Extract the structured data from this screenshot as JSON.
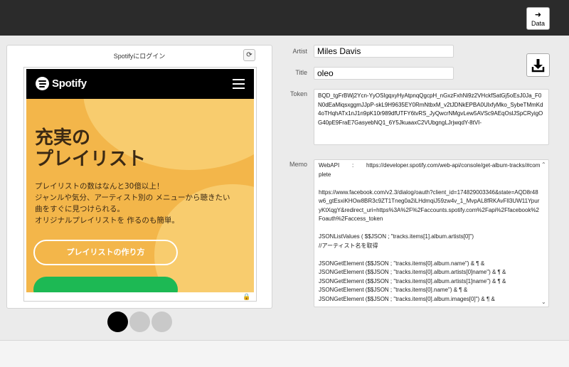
{
  "toolbar": {
    "data_label": "Data",
    "data_icon": "arrow-right-icon"
  },
  "webview": {
    "title": "Spotifyにログイン",
    "spotify": {
      "brand": "Spotify",
      "headline": "充実の\nプレイリスト",
      "body": "プレイリストの数はなんと30億以上！\nジャンルや気分、アーティスト別の メニューから聴きたい\n曲をすぐに見つけられる。\nオリジナルプレイリストを 作るのも簡単。",
      "cta": "プレイリストの作り方",
      "brand_color": "#1db954",
      "hero_color": "#f3b64a"
    }
  },
  "pager": {
    "count": 3,
    "active": 0
  },
  "form": {
    "artist_label": "Artist",
    "artist_value": "Miles Davis",
    "title_label": "Title",
    "title_value": "oleo",
    "token_label": "Token",
    "token_value": "BQD_tgFrBWj2Ycn-YyOSIgqxyHyAtpnqQgcpH_nGxzFxhNi9z2VHckfSatGj5oEsJ0Ja_F0N0dEaMiqsxggmJJpP-skL9H9635EY0RmNtbxM_v2tJDNkEPBA0UlxfyMko_SybeTMmKd4oTHqhATx1nJ1n9pK10r989dfUTFY6tvRS_JyQwcrNMgvLew5AVSc9AEqOslJSpCRyigOG40pE9FraE7GasyebNQ1_6Y5JkuaaxC2VUbgngLJrjwqdY-8tVI-",
    "memo_label": "Memo",
    "memo_value": "WebAPI        :        https://developer.spotify.com/web-api/console/get-album-tracks/#complete\n\nhttps://www.facebook.com/v2.3/dialog/oauth?client_id=174829003346&state=AQD8r48w6_gtEsxiKHOw8BR3c9ZT1Tneg0a2iLHdmqiJ59zw4v_1_MvpAL8fRKAvFll3UW11YpuryKtXqgY&redirect_uri=https%3A%2F%2Faccounts.spotify.com%2Fapi%2Ffacebook%2Foauth%2Faccess_token\n\nJSONListValues ( $$JSON ; \"tracks.items[1].album.artists[0]\")\n//アーティスト名を取得\n\nJSONGetElement ($$JSON ; \"tracks.items[0].album.name\") & ¶ &\nJSONGetElement ($$JSON ; \"tracks.items[0].album.artists[0]name\") & ¶ &\nJSONGetElement ($$JSON ; \"tracks.items[0].album.artists[1]name\") & ¶ &\nJSONGetElement ($$JSON ; \"tracks.items[0].name\") & ¶ &\nJSONGetElement ($$JSON ; \"tracks.items[0].album.images[0]\") & ¶ &"
  },
  "download_icon": "download-icon"
}
